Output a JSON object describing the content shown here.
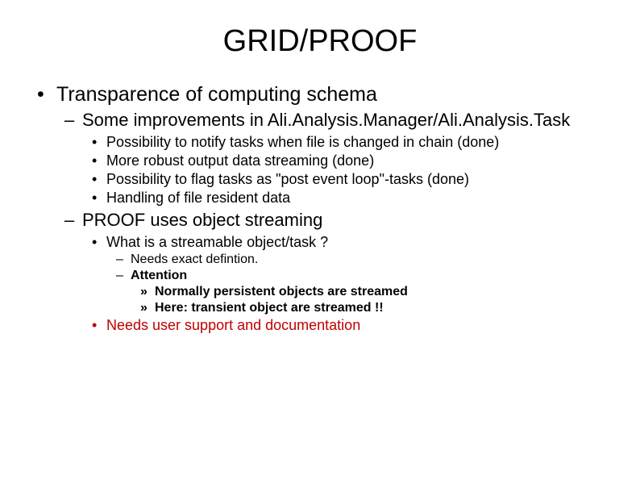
{
  "title": "GRID/PROOF",
  "b1": "Transparence of computing schema",
  "b1_1": "Some improvements in Ali.Analysis.Manager/Ali.Analysis.Task",
  "b1_1_1": "Possibility to notify tasks when file is changed in chain (done)",
  "b1_1_2": "More robust output data streaming (done)",
  "b1_1_3": "Possibility to flag tasks as \"post event loop\"-tasks (done)",
  "b1_1_4": "Handling of file resident data",
  "b1_2": "PROOF uses object streaming",
  "b1_2_1": "What is a streamable object/task ?",
  "b1_2_1_1": "Needs exact defintion.",
  "b1_2_1_2": "Attention",
  "b1_2_1_2_1": "Normally persistent objects are streamed",
  "b1_2_1_2_2": "Here: transient object are streamed !!",
  "b1_2_2": "Needs user support and documentation"
}
